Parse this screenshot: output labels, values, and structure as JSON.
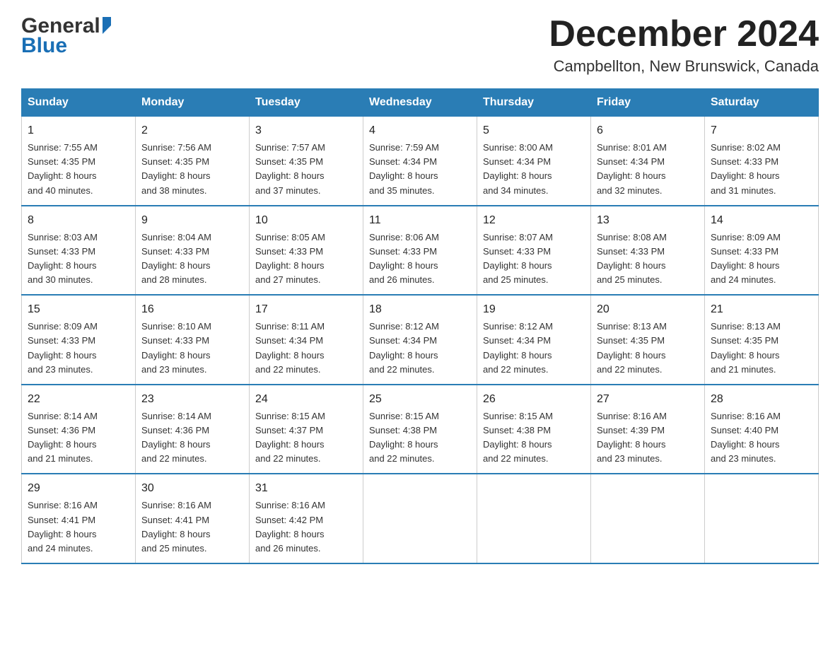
{
  "header": {
    "title": "December 2024",
    "subtitle": "Campbellton, New Brunswick, Canada",
    "logo_general": "General",
    "logo_blue": "Blue"
  },
  "days_of_week": [
    "Sunday",
    "Monday",
    "Tuesday",
    "Wednesday",
    "Thursday",
    "Friday",
    "Saturday"
  ],
  "weeks": [
    [
      {
        "date": "1",
        "sunrise": "7:55 AM",
        "sunset": "4:35 PM",
        "daylight": "8 hours and 40 minutes."
      },
      {
        "date": "2",
        "sunrise": "7:56 AM",
        "sunset": "4:35 PM",
        "daylight": "8 hours and 38 minutes."
      },
      {
        "date": "3",
        "sunrise": "7:57 AM",
        "sunset": "4:35 PM",
        "daylight": "8 hours and 37 minutes."
      },
      {
        "date": "4",
        "sunrise": "7:59 AM",
        "sunset": "4:34 PM",
        "daylight": "8 hours and 35 minutes."
      },
      {
        "date": "5",
        "sunrise": "8:00 AM",
        "sunset": "4:34 PM",
        "daylight": "8 hours and 34 minutes."
      },
      {
        "date": "6",
        "sunrise": "8:01 AM",
        "sunset": "4:34 PM",
        "daylight": "8 hours and 32 minutes."
      },
      {
        "date": "7",
        "sunrise": "8:02 AM",
        "sunset": "4:33 PM",
        "daylight": "8 hours and 31 minutes."
      }
    ],
    [
      {
        "date": "8",
        "sunrise": "8:03 AM",
        "sunset": "4:33 PM",
        "daylight": "8 hours and 30 minutes."
      },
      {
        "date": "9",
        "sunrise": "8:04 AM",
        "sunset": "4:33 PM",
        "daylight": "8 hours and 28 minutes."
      },
      {
        "date": "10",
        "sunrise": "8:05 AM",
        "sunset": "4:33 PM",
        "daylight": "8 hours and 27 minutes."
      },
      {
        "date": "11",
        "sunrise": "8:06 AM",
        "sunset": "4:33 PM",
        "daylight": "8 hours and 26 minutes."
      },
      {
        "date": "12",
        "sunrise": "8:07 AM",
        "sunset": "4:33 PM",
        "daylight": "8 hours and 25 minutes."
      },
      {
        "date": "13",
        "sunrise": "8:08 AM",
        "sunset": "4:33 PM",
        "daylight": "8 hours and 25 minutes."
      },
      {
        "date": "14",
        "sunrise": "8:09 AM",
        "sunset": "4:33 PM",
        "daylight": "8 hours and 24 minutes."
      }
    ],
    [
      {
        "date": "15",
        "sunrise": "8:09 AM",
        "sunset": "4:33 PM",
        "daylight": "8 hours and 23 minutes."
      },
      {
        "date": "16",
        "sunrise": "8:10 AM",
        "sunset": "4:33 PM",
        "daylight": "8 hours and 23 minutes."
      },
      {
        "date": "17",
        "sunrise": "8:11 AM",
        "sunset": "4:34 PM",
        "daylight": "8 hours and 22 minutes."
      },
      {
        "date": "18",
        "sunrise": "8:12 AM",
        "sunset": "4:34 PM",
        "daylight": "8 hours and 22 minutes."
      },
      {
        "date": "19",
        "sunrise": "8:12 AM",
        "sunset": "4:34 PM",
        "daylight": "8 hours and 22 minutes."
      },
      {
        "date": "20",
        "sunrise": "8:13 AM",
        "sunset": "4:35 PM",
        "daylight": "8 hours and 22 minutes."
      },
      {
        "date": "21",
        "sunrise": "8:13 AM",
        "sunset": "4:35 PM",
        "daylight": "8 hours and 21 minutes."
      }
    ],
    [
      {
        "date": "22",
        "sunrise": "8:14 AM",
        "sunset": "4:36 PM",
        "daylight": "8 hours and 21 minutes."
      },
      {
        "date": "23",
        "sunrise": "8:14 AM",
        "sunset": "4:36 PM",
        "daylight": "8 hours and 22 minutes."
      },
      {
        "date": "24",
        "sunrise": "8:15 AM",
        "sunset": "4:37 PM",
        "daylight": "8 hours and 22 minutes."
      },
      {
        "date": "25",
        "sunrise": "8:15 AM",
        "sunset": "4:38 PM",
        "daylight": "8 hours and 22 minutes."
      },
      {
        "date": "26",
        "sunrise": "8:15 AM",
        "sunset": "4:38 PM",
        "daylight": "8 hours and 22 minutes."
      },
      {
        "date": "27",
        "sunrise": "8:16 AM",
        "sunset": "4:39 PM",
        "daylight": "8 hours and 23 minutes."
      },
      {
        "date": "28",
        "sunrise": "8:16 AM",
        "sunset": "4:40 PM",
        "daylight": "8 hours and 23 minutes."
      }
    ],
    [
      {
        "date": "29",
        "sunrise": "8:16 AM",
        "sunset": "4:41 PM",
        "daylight": "8 hours and 24 minutes."
      },
      {
        "date": "30",
        "sunrise": "8:16 AM",
        "sunset": "4:41 PM",
        "daylight": "8 hours and 25 minutes."
      },
      {
        "date": "31",
        "sunrise": "8:16 AM",
        "sunset": "4:42 PM",
        "daylight": "8 hours and 26 minutes."
      },
      null,
      null,
      null,
      null
    ]
  ],
  "labels": {
    "sunrise": "Sunrise:",
    "sunset": "Sunset:",
    "daylight": "Daylight:"
  }
}
